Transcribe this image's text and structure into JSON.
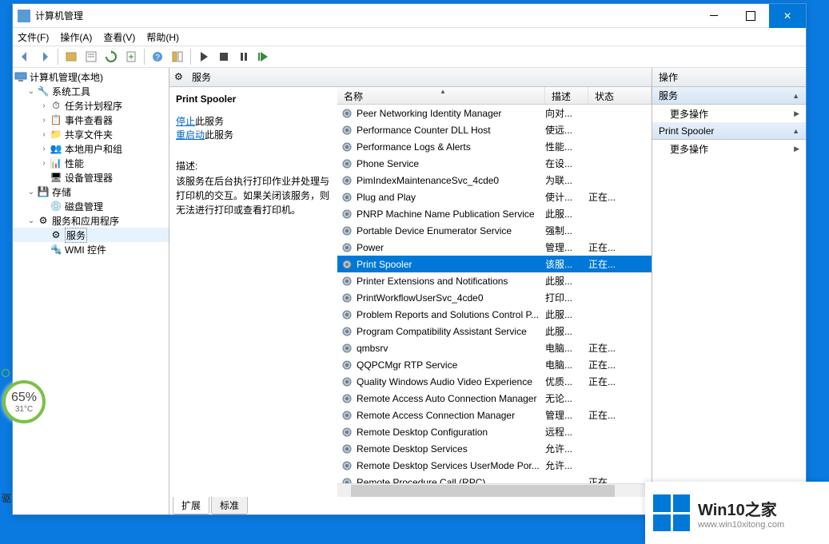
{
  "window": {
    "title": "计算机管理"
  },
  "menubar": [
    "文件(F)",
    "操作(A)",
    "查看(V)",
    "帮助(H)"
  ],
  "tree": {
    "root": "计算机管理(本地)",
    "sys_tools": "系统工具",
    "sys_children": [
      "任务计划程序",
      "事件查看器",
      "共享文件夹",
      "本地用户和组",
      "性能",
      "设备管理器"
    ],
    "storage": "存储",
    "storage_children": [
      "磁盘管理"
    ],
    "services_apps": "服务和应用程序",
    "services": "服务",
    "wmi": "WMI 控件"
  },
  "mid_header": "服务",
  "detail": {
    "title": "Print Spooler",
    "stop_link": "停止",
    "stop_suffix": "此服务",
    "restart_link": "重启动",
    "restart_suffix": "此服务",
    "desc_label": "描述:",
    "desc_text": "该服务在后台执行打印作业并处理与打印机的交互。如果关闭该服务，则无法进行打印或查看打印机。"
  },
  "columns": {
    "name": "名称",
    "desc": "描述",
    "status": "状态"
  },
  "services_list": [
    {
      "name": "Peer Networking Identity Manager",
      "desc": "向对...",
      "status": ""
    },
    {
      "name": "Performance Counter DLL Host",
      "desc": "使远...",
      "status": ""
    },
    {
      "name": "Performance Logs & Alerts",
      "desc": "性能...",
      "status": ""
    },
    {
      "name": "Phone Service",
      "desc": "在设...",
      "status": ""
    },
    {
      "name": "PimIndexMaintenanceSvc_4cde0",
      "desc": "为联...",
      "status": ""
    },
    {
      "name": "Plug and Play",
      "desc": "使计...",
      "status": "正在..."
    },
    {
      "name": "PNRP Machine Name Publication Service",
      "desc": "此服...",
      "status": ""
    },
    {
      "name": "Portable Device Enumerator Service",
      "desc": "强制...",
      "status": ""
    },
    {
      "name": "Power",
      "desc": "管理...",
      "status": "正在..."
    },
    {
      "name": "Print Spooler",
      "desc": "该服...",
      "status": "正在...",
      "selected": true
    },
    {
      "name": "Printer Extensions and Notifications",
      "desc": "此服...",
      "status": ""
    },
    {
      "name": "PrintWorkflowUserSvc_4cde0",
      "desc": "打印...",
      "status": ""
    },
    {
      "name": "Problem Reports and Solutions Control P...",
      "desc": "此服...",
      "status": ""
    },
    {
      "name": "Program Compatibility Assistant Service",
      "desc": "此服...",
      "status": ""
    },
    {
      "name": "qmbsrv",
      "desc": "电脑...",
      "status": "正在..."
    },
    {
      "name": "QQPCMgr RTP Service",
      "desc": "电脑...",
      "status": "正在..."
    },
    {
      "name": "Quality Windows Audio Video Experience",
      "desc": "优质...",
      "status": "正在..."
    },
    {
      "name": "Remote Access Auto Connection Manager",
      "desc": "无论...",
      "status": ""
    },
    {
      "name": "Remote Access Connection Manager",
      "desc": "管理...",
      "status": "正在..."
    },
    {
      "name": "Remote Desktop Configuration",
      "desc": "远程...",
      "status": ""
    },
    {
      "name": "Remote Desktop Services",
      "desc": "允许...",
      "status": ""
    },
    {
      "name": "Remote Desktop Services UserMode Por...",
      "desc": "允许...",
      "status": ""
    },
    {
      "name": "Remote Procedure Call (RPC)",
      "desc": "",
      "status": "正在..."
    }
  ],
  "footer_tabs": {
    "extended": "扩展",
    "standard": "标准"
  },
  "actions": {
    "header": "操作",
    "section1": "服务",
    "item1": "更多操作",
    "section2": "Print Spooler",
    "item2": "更多操作"
  },
  "cpu_widget": {
    "pct": "65%",
    "temp": "31°C"
  },
  "logo": {
    "line1": "Win10之家",
    "line2": "www.win10xitong.com"
  },
  "drive_label": "驱"
}
